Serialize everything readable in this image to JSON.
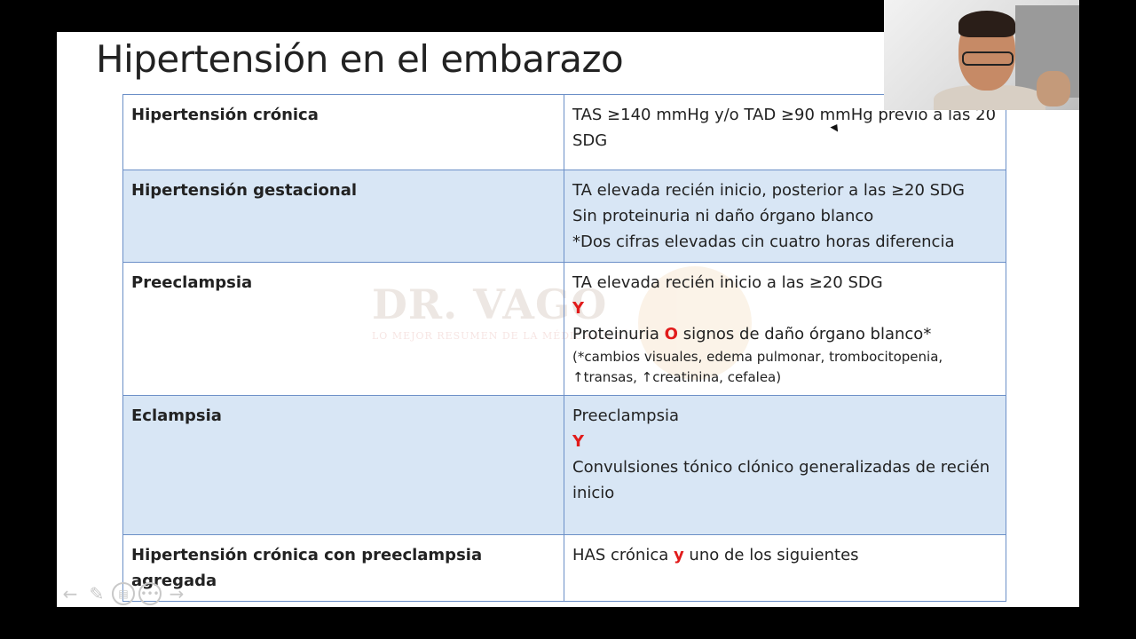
{
  "slide": {
    "title": "Hipertensión en el embarazo",
    "watermark": {
      "name": "DR. VAGO",
      "tagline": "LO MEJOR RESUMEN DE LA MÉDICA EN LÍNEA"
    },
    "rows": [
      {
        "term": "Hipertensión crónica",
        "lines": [
          "TAS ≥140 mmHg y/o TAD ≥90 mmHg previo a las 20 SDG"
        ]
      },
      {
        "term": "Hipertensión gestacional",
        "lines": [
          "TA elevada recién inicio, posterior a las ≥20 SDG",
          "Sin proteinuria ni daño órgano blanco",
          "*Dos cifras elevadas cin cuatro horas diferencia"
        ]
      },
      {
        "term": "Preeclampsia",
        "line1": "TA elevada recién inicio a las ≥20 SDG",
        "conj": "Y",
        "line2_pre": "Proteinuria ",
        "line2_conj": "O",
        "line2_post": " signos de daño órgano blanco*",
        "note1": "(*cambios visuales, edema pulmonar, trombocitopenia,",
        "note2": "↑transas, ↑creatinina, cefalea)"
      },
      {
        "term": "Eclampsia",
        "line1": "Preeclampsia",
        "conj": "Y",
        "line2": "Convulsiones tónico clónico generalizadas de recién inicio"
      },
      {
        "term": "Hipertensión crónica con preeclampsia agregada",
        "line_pre": "HAS crónica ",
        "line_conj": "y",
        "line_post": " uno de los siguientes"
      }
    ]
  },
  "controls": {
    "prev_icon": "←",
    "pen_icon": "✎",
    "slides_icon": "▤",
    "more_icon": "•••",
    "next_icon": "→"
  }
}
